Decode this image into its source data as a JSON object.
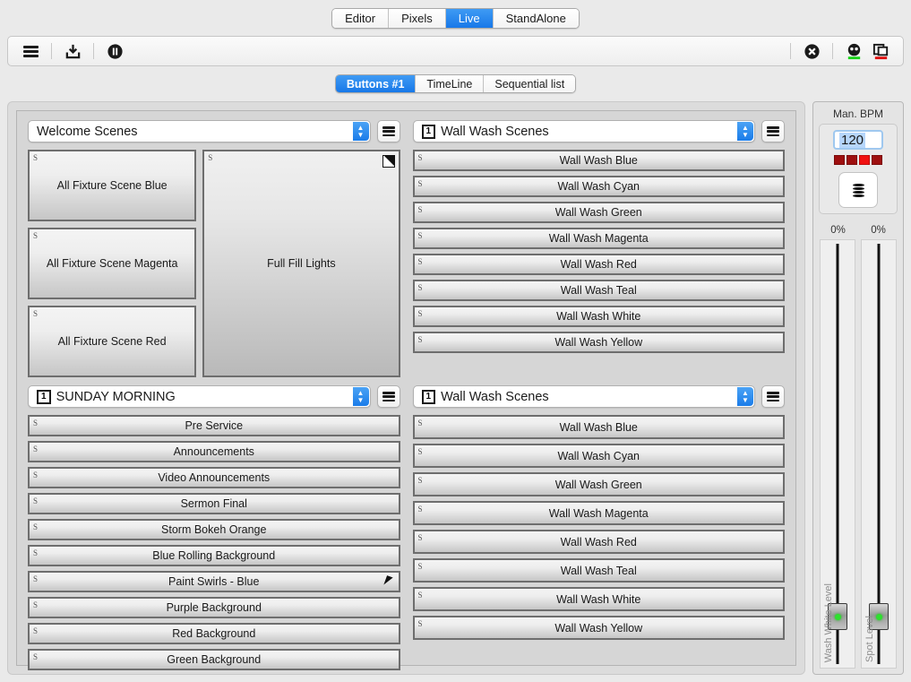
{
  "top_tabs": [
    {
      "label": "Editor",
      "active": false
    },
    {
      "label": "Pixels",
      "active": false
    },
    {
      "label": "Live",
      "active": true
    },
    {
      "label": "StandAlone",
      "active": false
    }
  ],
  "toolbar": {
    "left_icons": [
      "hamburger-menu-icon",
      "save-download-icon",
      "pause-icon"
    ],
    "right_icons": [
      "close-circle-icon",
      "blackout-icon",
      "window-duplicate-icon"
    ]
  },
  "main_tabs": [
    {
      "label": "Buttons #1",
      "active": true
    },
    {
      "label": "TimeLine",
      "active": false
    },
    {
      "label": "Sequential list",
      "active": false
    }
  ],
  "panels": {
    "top_left": {
      "title": "Welcome Scenes",
      "badge": "",
      "buttons": [
        {
          "label": "All Fixture Scene Blue",
          "glyph": "S"
        },
        {
          "label": "All Fixture Scene Magenta",
          "glyph": "S"
        },
        {
          "label": "All Fixture Scene Red",
          "glyph": "S"
        }
      ],
      "fill_button": {
        "label": "Full Fill Lights",
        "glyph": "S",
        "corner_icon": "gradient-resize-icon"
      }
    },
    "top_right": {
      "title": "Wall Wash Scenes",
      "badge": "1",
      "buttons": [
        {
          "label": "Wall Wash Blue",
          "glyph": "S"
        },
        {
          "label": "Wall Wash Cyan",
          "glyph": "S"
        },
        {
          "label": "Wall Wash Green",
          "glyph": "S"
        },
        {
          "label": "Wall Wash Magenta",
          "glyph": "S"
        },
        {
          "label": "Wall Wash Red",
          "glyph": "S"
        },
        {
          "label": "Wall Wash Teal",
          "glyph": "S"
        },
        {
          "label": "Wall Wash White",
          "glyph": "S"
        },
        {
          "label": "Wall Wash Yellow",
          "glyph": "S"
        }
      ]
    },
    "bottom_left": {
      "title": "SUNDAY MORNING",
      "badge": "1",
      "buttons": [
        {
          "label": "Pre Service",
          "glyph": "S"
        },
        {
          "label": "Announcements",
          "glyph": "S"
        },
        {
          "label": "Video Announcements",
          "glyph": "S"
        },
        {
          "label": "Sermon Final",
          "glyph": "S"
        },
        {
          "label": "Storm Bokeh Orange",
          "glyph": "S"
        },
        {
          "label": "Blue Rolling Background",
          "glyph": "S"
        },
        {
          "label": "Paint Swirls - Blue",
          "glyph": "S",
          "cursor": true
        },
        {
          "label": "Purple Background",
          "glyph": "S"
        },
        {
          "label": "Red Background",
          "glyph": "S"
        },
        {
          "label": "Green Background",
          "glyph": "S"
        }
      ]
    },
    "bottom_right": {
      "title": "Wall Wash Scenes",
      "badge": "1",
      "buttons": [
        {
          "label": "Wall Wash Blue",
          "glyph": "S"
        },
        {
          "label": "Wall Wash Cyan",
          "glyph": "S"
        },
        {
          "label": "Wall Wash Green",
          "glyph": "S"
        },
        {
          "label": "Wall Wash Magenta",
          "glyph": "S"
        },
        {
          "label": "Wall Wash Red",
          "glyph": "S"
        },
        {
          "label": "Wall Wash Teal",
          "glyph": "S"
        },
        {
          "label": "Wall Wash White",
          "glyph": "S"
        },
        {
          "label": "Wall Wash Yellow",
          "glyph": "S"
        }
      ]
    }
  },
  "bpm": {
    "label": "Man. BPM",
    "value": "120",
    "beats": [
      false,
      false,
      true,
      false
    ],
    "tap_icon": "tap-tempo-drum-icon"
  },
  "faders": [
    {
      "percent": "0%",
      "label": "Wash White Level"
    },
    {
      "percent": "0%",
      "label": "Spot Level"
    }
  ],
  "colors": {
    "accent_blue": "#1878e8",
    "beat_red": "#9e0f0f",
    "beat_red_lit": "#f01010",
    "led_green": "#2ee02e",
    "window_bg": "#eaeaea",
    "panel_bg": "#d6d6d6"
  }
}
